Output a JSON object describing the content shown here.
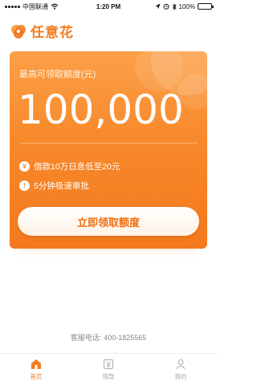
{
  "status_bar": {
    "carrier": "中国联通",
    "time": "1:20 PM",
    "battery": "100%"
  },
  "header": {
    "brand": "任意花"
  },
  "card": {
    "label": "最高可领取额度(元)",
    "amount": "100,000",
    "features": [
      {
        "icon": "¥",
        "text": "借款10万日息低至20元"
      },
      {
        "icon": "!",
        "text": "5分钟极速审批"
      }
    ],
    "cta_label": "立即领取额度"
  },
  "service": {
    "label": "客服电话:",
    "phone": "400-1825565"
  },
  "tabs": [
    {
      "label": "首页",
      "active": true
    },
    {
      "label": "借款",
      "active": false
    },
    {
      "label": "我的",
      "active": false
    }
  ],
  "colors": {
    "brand": "#f47b20",
    "card_top": "#fca048",
    "card_bottom": "#f4791d"
  }
}
